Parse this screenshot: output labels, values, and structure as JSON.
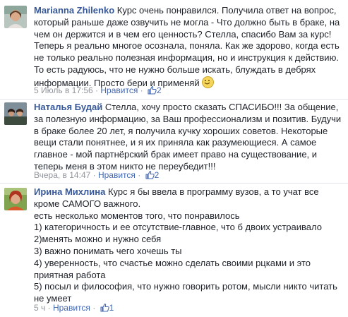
{
  "comments": [
    {
      "author": "Marianna Zhilenko",
      "text": "Курс очень понравился. Получила ответ на вопрос, который раньше даже озвучить не могла - Что должно быть в браке, на чем он держится и в чем его ценность? Стелла, спасибо Вам за курс! Теперь я реально многое осознала, поняла. Как же здорово, когда есть не только реально полезная информация, но и инструкция к действию. То есть радуюсь, что не нужно больше искать, блуждать в дебрях информации. Просто бери и применяй",
      "emoji": "smiley-emoji",
      "time": "5 Июль в 17:56",
      "like_label": "Нравится",
      "likes": "2"
    },
    {
      "author": "Наталья Будай",
      "text": "Стелла, хочу просто сказать СПАСИБО!!! За общение, за полезную информацию, за Ваш профессионализм и позитив. Будучи в браке более 20 лет, я получила кучку хороших советов. Некоторые вещи стали понятнее, и я их приняла как разумеющиеся. А самое главное - мой партнёрский брак имеет право на существование, и теперь меня в этом никто не переубедит!!!",
      "time": "Вчера, в 14:47",
      "like_label": "Нравится",
      "likes": "2"
    },
    {
      "author": "Ирина Михлина",
      "text": "Курс я бы ввела в программу вузов, а то учат все кроме САМОГО важного.\nесть несколько моментов того, что понравилось\n1) категоричность и ее отсутствие-главное, что б двоих устраивало\n2)менять можно и нужно себя\n3) важно понимать чего хочешь ты\n4) уверенность, что счастье можно сделать своими рцками и это приятная работа\n5) посыл и философия, что нужно говорить ротом, мысли никто читать не умеет",
      "time": "5 ч",
      "like_label": "Нравится",
      "likes": "1"
    }
  ],
  "colors": {
    "author": "#365899",
    "link": "#4267b2",
    "meta": "#90949c",
    "separator": "#e5e6e9"
  }
}
